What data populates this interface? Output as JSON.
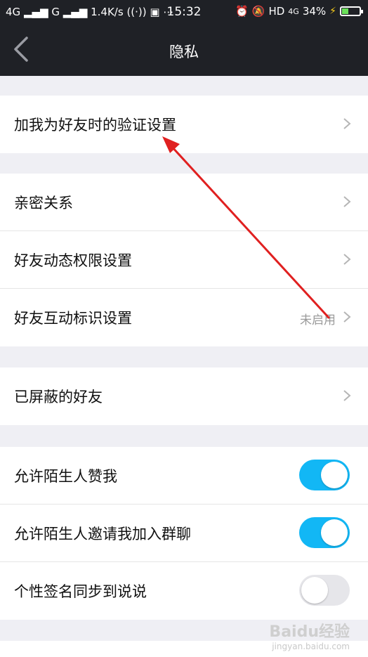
{
  "status_bar": {
    "network_left": "4G",
    "network_right": "G",
    "speed": "1.4K/s",
    "extra": "⋯",
    "time": "15:32",
    "hd": "HD",
    "four_g": "4G",
    "battery_percent": "34%",
    "battery_level": 0.34
  },
  "nav": {
    "title": "隐私"
  },
  "groups": [
    {
      "rows": [
        {
          "label": "加我为好友时的验证设置"
        }
      ]
    },
    {
      "rows": [
        {
          "label": "亲密关系"
        },
        {
          "label": "好友动态权限设置"
        },
        {
          "label": "好友互动标识设置",
          "value": "未启用"
        }
      ]
    },
    {
      "rows": [
        {
          "label": "已屏蔽的好友"
        }
      ]
    },
    {
      "rows": [
        {
          "label": "允许陌生人赞我",
          "toggle": true
        },
        {
          "label": "允许陌生人邀请我加入群聊",
          "toggle": true
        },
        {
          "label": "个性签名同步到说说",
          "toggle": false
        }
      ]
    }
  ],
  "watermark": {
    "brand": "Baidu经验",
    "url": "jingyan.baidu.com"
  },
  "colors": {
    "bar_bg": "#1f2126",
    "toggle_on": "#12b7f5",
    "toggle_off": "#e6e6ea",
    "annotation_arrow": "#e02020"
  }
}
